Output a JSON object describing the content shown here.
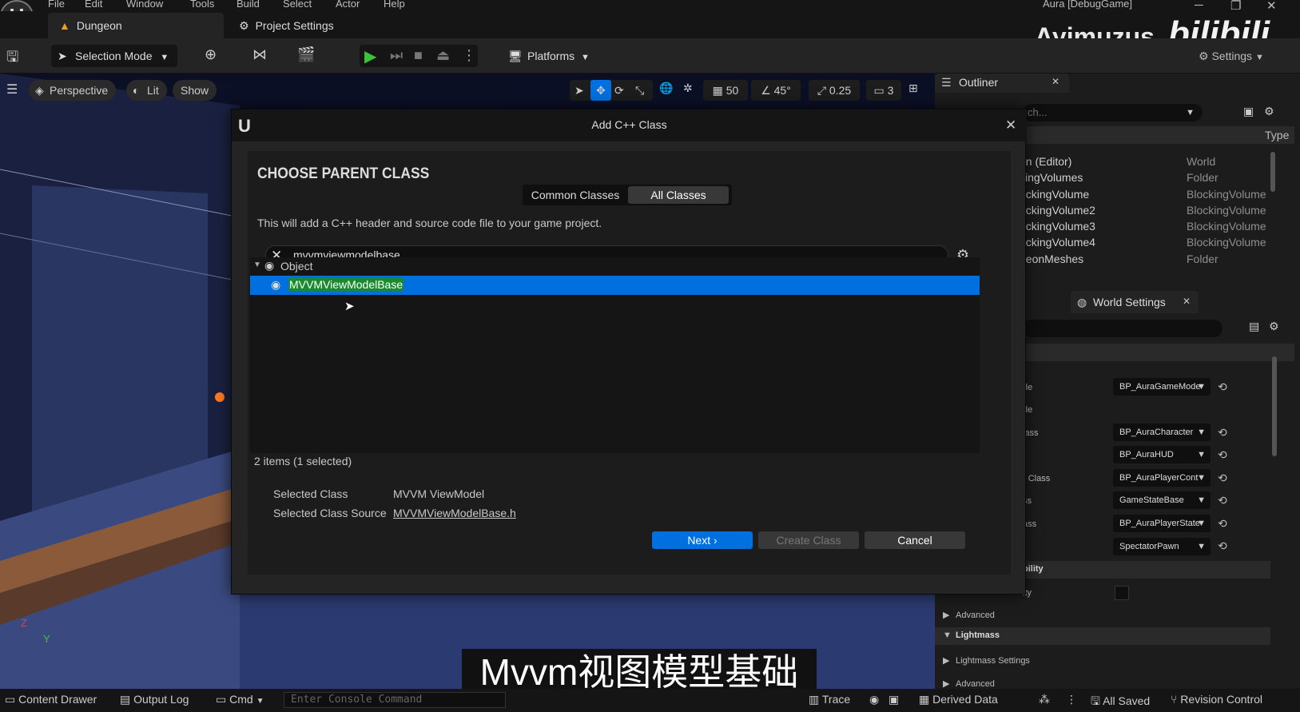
{
  "menu": [
    "File",
    "Edit",
    "Window",
    "Tools",
    "Build",
    "Select",
    "Actor",
    "Help"
  ],
  "window_title": "Aura [DebugGame]",
  "tabs": {
    "level": "Dungeon",
    "settings": "Project Settings"
  },
  "watermark": {
    "name": "Ayimuzus",
    "site": "bilibili"
  },
  "toolbar": {
    "selection_mode": "Selection Mode",
    "platforms": "Platforms",
    "settings": "Settings"
  },
  "viewport": {
    "perspective": "Perspective",
    "lit": "Lit",
    "show": "Show",
    "grid_snap": "50",
    "rotation_snap": "45°",
    "scale_snap": "0.25",
    "camera_speed": "3",
    "axis_z": "Z",
    "axis_y": "Y"
  },
  "outliner": {
    "title": "Outliner",
    "search_placeholder": "ch...",
    "col_type": "Type",
    "rows": [
      {
        "label": "on (Editor)",
        "type": "World"
      },
      {
        "label": "kingVolumes",
        "type": "Folder"
      },
      {
        "label": "ockingVolume",
        "type": "BlockingVolume"
      },
      {
        "label": "ockingVolume2",
        "type": "BlockingVolume"
      },
      {
        "label": "ockingVolume3",
        "type": "BlockingVolume"
      },
      {
        "label": "ockingVolume4",
        "type": "BlockingVolume"
      },
      {
        "label": "geonMeshes",
        "type": "Folder"
      }
    ]
  },
  "world_settings": {
    "title": "World Settings",
    "rows": [
      {
        "label": "de",
        "value": "BP_AuraGameMode"
      },
      {
        "label": "de",
        "value": ""
      },
      {
        "label": "lass",
        "value": "BP_AuraCharacter"
      },
      {
        "label": "",
        "value": "BP_AuraHUD"
      },
      {
        "label": "r Class",
        "value": "BP_AuraPlayerCont"
      },
      {
        "label": "ss",
        "value": "GameStateBase"
      },
      {
        "label": "ass",
        "value": "BP_AuraPlayerState"
      },
      {
        "label": "",
        "value": "SpectatorPawn"
      }
    ],
    "section_bility": "bility",
    "ity": "ity",
    "advanced": "Advanced",
    "lightmass": "Lightmass",
    "lightmass_settings": "Lightmass Settings",
    "advanced2": "Advanced"
  },
  "dialog": {
    "title": "Add C++ Class",
    "heading": "CHOOSE PARENT CLASS",
    "tab_common": "Common Classes",
    "tab_all": "All Classes",
    "description": "This will add a C++ header and source code file to your game project.",
    "search_value": "mvvmviewmodelbase",
    "tree_root": "Object",
    "tree_selected": "MVVMViewModelBase",
    "count": "2 items (1 selected)",
    "selected_class_label": "Selected Class",
    "selected_class_value": "MVVM ViewModel",
    "selected_source_label": "Selected Class Source",
    "selected_source_value": "MVVMViewModelBase.h",
    "next": "Next",
    "create": "Create Class",
    "cancel": "Cancel"
  },
  "subtitle": "Mvvm视图模型基础",
  "status": {
    "content_drawer": "Content Drawer",
    "output_log": "Output Log",
    "cmd": "Cmd",
    "console_placeholder": "Enter Console Command",
    "trace": "Trace",
    "derived_data": "Derived Data",
    "all_saved": "All Saved",
    "revision_control": "Revision Control"
  },
  "colors": {
    "accent": "#0070e0",
    "selection_highlight": "#1a8a30",
    "play_green": "#3ec23e"
  }
}
